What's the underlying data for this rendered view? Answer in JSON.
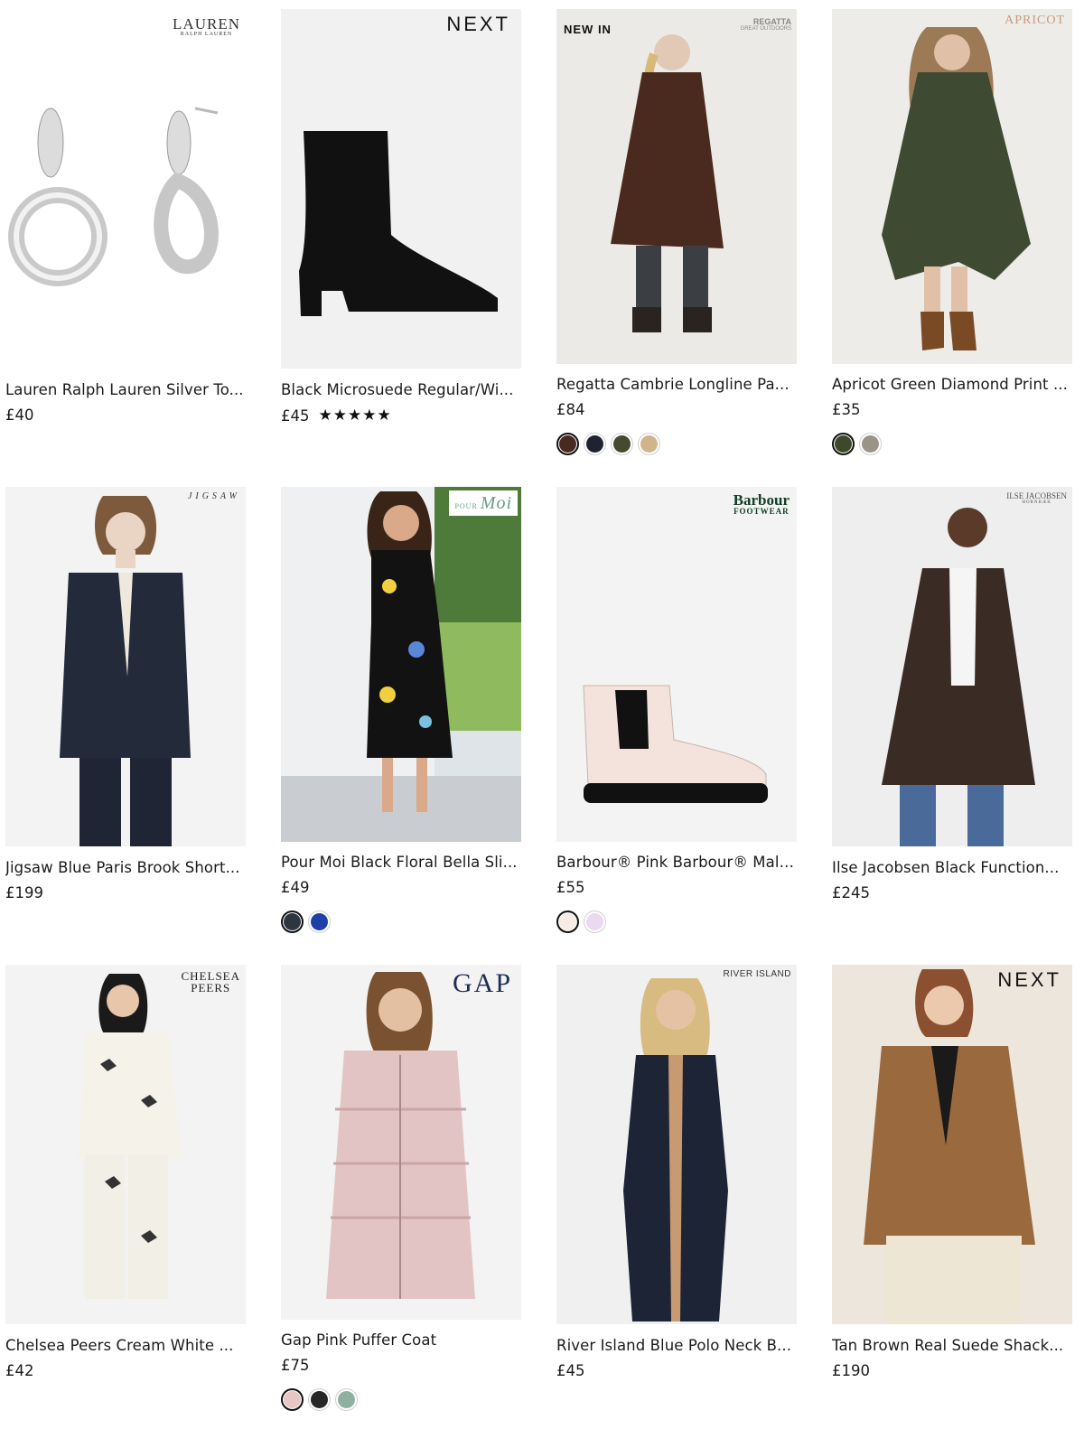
{
  "products": [
    {
      "brand": "LAUREN",
      "brand_sub": "RALPH LAUREN",
      "title": "Lauren Ralph Lauren Silver To...",
      "price": "£40"
    },
    {
      "brand": "NEXT",
      "title": "Black Microsuede Regular/Wi...",
      "price": "£45",
      "rating": "★★★★★"
    },
    {
      "badge": "NEW IN",
      "brand": "REGATTA",
      "brand_sub": "GREAT OUTDOORS",
      "title": "Regatta Cambrie Longline Pa...",
      "price": "£84",
      "swatches": [
        "#4a2a1f",
        "#1f2230",
        "#474a2e",
        "#d2b48c"
      ]
    },
    {
      "brand": "APRICOT",
      "title": "Apricot Green Diamond Print ...",
      "price": "£35",
      "swatches": [
        "#3d4a2a",
        "#9a9488"
      ]
    },
    {
      "brand": "JIGSAW",
      "title": "Jigsaw Blue Paris Brook Short...",
      "price": "£199"
    },
    {
      "brand": "POUR",
      "brand_sub": "Moi",
      "title": "Pour Moi Black Floral Bella Sli...",
      "price": "£49",
      "swatches": [
        "#2c3540",
        "#1f3fa8"
      ]
    },
    {
      "brand": "Barbour",
      "brand_sub": "FOOTWEAR",
      "title": "Barbour® Pink Barbour® Mallo...",
      "price": "£55",
      "swatches": [
        "#f6ece4",
        "#ead9f0"
      ]
    },
    {
      "brand": "ILSE JACOBSEN",
      "brand_sub": "HORNBÆK",
      "title": "Ilse Jacobsen Black Function...",
      "price": "£245"
    },
    {
      "brand": "CHELSEA",
      "brand_sub": "PEERS",
      "title": "Chelsea Peers Cream White ...",
      "price": "£42"
    },
    {
      "brand": "GAP",
      "title": "Gap Pink Puffer Coat",
      "price": "£75",
      "swatches": [
        "#e7c6c6",
        "#262626",
        "#8fb0a0"
      ]
    },
    {
      "brand": "RIVER ISLAND",
      "title": "River Island Blue Polo Neck B...",
      "price": "£45"
    },
    {
      "brand": "NEXT",
      "title": "Tan Brown Real Suede Shack...",
      "price": "£190"
    }
  ]
}
